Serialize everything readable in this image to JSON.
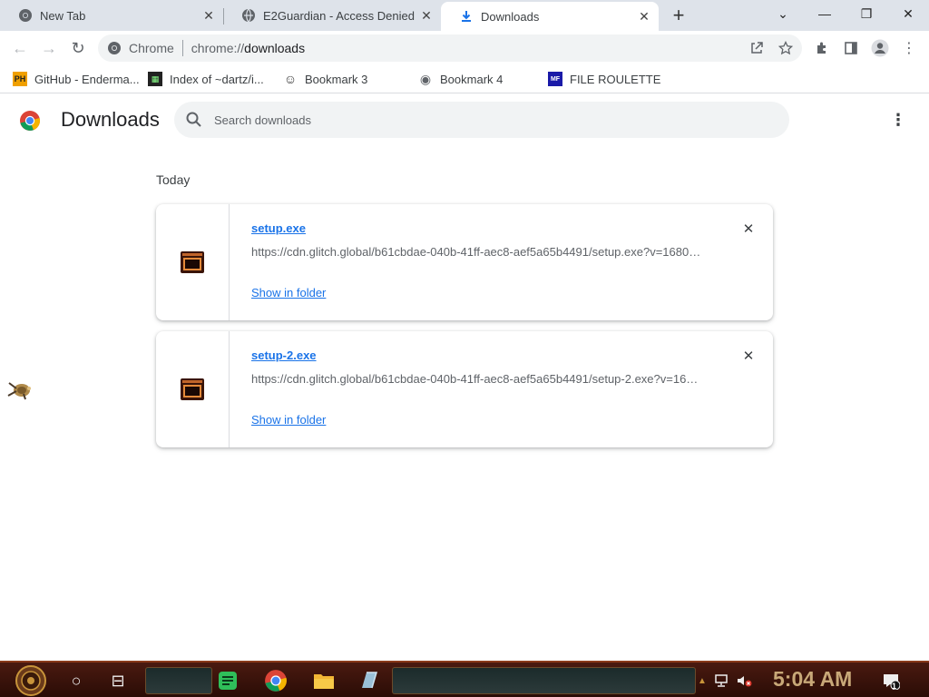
{
  "window": {
    "tabs": [
      {
        "title": "New Tab",
        "icon": "chrome-icon",
        "active": false
      },
      {
        "title": "E2Guardian - Access Denied",
        "icon": "globe-icon",
        "active": false
      },
      {
        "title": "Downloads",
        "icon": "download-icon",
        "active": true
      }
    ],
    "new_tab_glyph": "+",
    "tab_search_glyph": "⌄",
    "minimize_glyph": "—",
    "restore_glyph": "❐",
    "close_glyph": "✕",
    "tab_close_glyph": "✕"
  },
  "toolbar": {
    "back_glyph": "←",
    "forward_glyph": "→",
    "reload_glyph": "↻",
    "omnibox": {
      "chip_label": "Chrome",
      "url_scheme": "chrome://",
      "url_path": "downloads"
    },
    "more_glyph": "⋮"
  },
  "bookmarks": [
    {
      "label": "GitHub - Enderma...",
      "icon_text": "PH",
      "icon_color": "#f0a000"
    },
    {
      "label": "Index of ~dartz/i...",
      "icon_text": "▦",
      "icon_color": "#222222"
    },
    {
      "label": "Bookmark 3",
      "icon_text": "☺",
      "icon_color": "#333333"
    },
    {
      "label": "Bookmark 4",
      "icon_text": "◉",
      "icon_color": "#5f6368"
    },
    {
      "label": "FILE ROULETTE",
      "icon_text": "MF",
      "icon_color": "#1a1aa8"
    }
  ],
  "downloads_page": {
    "title": "Downloads",
    "search_placeholder": "Search downloads",
    "more_glyph": "⋮",
    "date_header": "Today",
    "items": [
      {
        "file_name": "setup.exe",
        "url": "https://cdn.glitch.global/b61cbdae-040b-41ff-aec8-aef5a65b4491/setup.exe?v=1680…",
        "action_label": "Show in folder",
        "remove_glyph": "✕"
      },
      {
        "file_name": "setup-2.exe",
        "url": "https://cdn.glitch.global/b61cbdae-040b-41ff-aec8-aef5a65b4491/setup-2.exe?v=16…",
        "action_label": "Show in folder",
        "remove_glyph": "✕"
      }
    ]
  },
  "taskbar": {
    "clock": "5:04 AM",
    "search_glyph": "○",
    "task_view_glyph": "⊟",
    "notification_count": "1"
  },
  "colors": {
    "accent": "#1a73e8",
    "tabstrip": "#dee3ea",
    "taskbar": "#3a130a",
    "clock": "#c8a878"
  }
}
